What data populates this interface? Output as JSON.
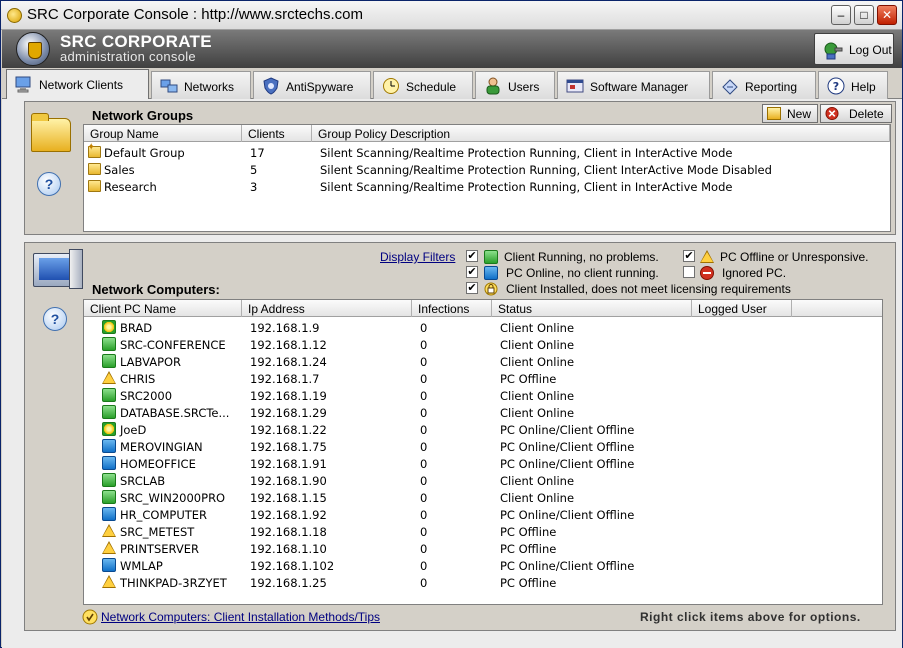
{
  "window": {
    "title": "SRC Corporate Console : http://www.srctechs.com"
  },
  "header": {
    "brand_line1": "SRC CORPORATE",
    "brand_line2": "administration console",
    "logout_label": "Log Out"
  },
  "tabs": [
    {
      "label": "Network Clients",
      "icon": "computer-icon",
      "active": true
    },
    {
      "label": "Networks",
      "icon": "network-icon",
      "active": false
    },
    {
      "label": "AntiSpyware",
      "icon": "shield-icon",
      "active": false
    },
    {
      "label": "Schedule",
      "icon": "clock-icon",
      "active": false
    },
    {
      "label": "Users",
      "icon": "user-icon",
      "active": false
    },
    {
      "label": "Software Manager",
      "icon": "software-icon",
      "active": false
    },
    {
      "label": "Reporting",
      "icon": "report-icon",
      "active": false
    },
    {
      "label": "Help",
      "icon": "help-icon",
      "active": false
    }
  ],
  "groups": {
    "title": "Network Groups",
    "new_label": "New",
    "delete_label": "Delete",
    "columns": [
      "Group Name",
      "Clients",
      "Group Policy Description"
    ],
    "rows": [
      {
        "name": "Default Group",
        "clients": "17",
        "policy": "Silent Scanning/Realtime Protection Running, Client in InterActive Mode"
      },
      {
        "name": "Sales",
        "clients": "5",
        "policy": "Silent Scanning/Realtime Protection Running, Client InterActive Mode Disabled"
      },
      {
        "name": "Research",
        "clients": "3",
        "policy": "Silent Scanning/Realtime Protection Running, Client in InterActive Mode"
      }
    ]
  },
  "computers": {
    "title": "Network Computers:",
    "filters_label": "Display Filters",
    "filters": [
      {
        "label": "Client Running, no problems.",
        "checked": true,
        "icon": "green-status-icon"
      },
      {
        "label": "PC Offline or Unresponsive.",
        "checked": true,
        "icon": "warning-icon"
      },
      {
        "label": "PC Online, no client running.",
        "checked": true,
        "icon": "blue-status-icon"
      },
      {
        "label": "Ignored PC.",
        "checked": false,
        "icon": "ignored-icon"
      },
      {
        "label": "Client Installed, does not meet licensing requirements",
        "checked": true,
        "icon": "license-icon"
      }
    ],
    "columns": [
      "Client PC Name",
      "Ip Address",
      "Infections",
      "Status",
      "Logged User"
    ],
    "rows": [
      {
        "name": "BRAD",
        "ip": "192.168.1.9",
        "infections": "0",
        "status": "Client Online",
        "icon": "star"
      },
      {
        "name": "SRC-CONFERENCE",
        "ip": "192.168.1.12",
        "infections": "0",
        "status": "Client Online",
        "icon": "green"
      },
      {
        "name": "LABVAPOR",
        "ip": "192.168.1.24",
        "infections": "0",
        "status": "Client Online",
        "icon": "green"
      },
      {
        "name": "CHRIS",
        "ip": "192.168.1.7",
        "infections": "0",
        "status": "PC Offline",
        "icon": "warn"
      },
      {
        "name": "SRC2000",
        "ip": "192.168.1.19",
        "infections": "0",
        "status": "Client Online",
        "icon": "green"
      },
      {
        "name": "DATABASE.SRCTe...",
        "ip": "192.168.1.29",
        "infections": "0",
        "status": "Client Online",
        "icon": "green"
      },
      {
        "name": "JoeD",
        "ip": "192.168.1.22",
        "infections": "0",
        "status": "PC Online/Client Offline",
        "icon": "star"
      },
      {
        "name": "MEROVINGIAN",
        "ip": "192.168.1.75",
        "infections": "0",
        "status": "PC Online/Client Offline",
        "icon": "blue"
      },
      {
        "name": "HOMEOFFICE",
        "ip": "192.168.1.91",
        "infections": "0",
        "status": "PC Online/Client Offline",
        "icon": "blue"
      },
      {
        "name": "SRCLAB",
        "ip": "192.168.1.90",
        "infections": "0",
        "status": "Client Online",
        "icon": "green"
      },
      {
        "name": "SRC_WIN2000PRO",
        "ip": "192.168.1.15",
        "infections": "0",
        "status": "Client Online",
        "icon": "green"
      },
      {
        "name": "HR_COMPUTER",
        "ip": "192.168.1.92",
        "infections": "0",
        "status": "PC Online/Client Offline",
        "icon": "blue"
      },
      {
        "name": "SRC_METEST",
        "ip": "192.168.1.18",
        "infections": "0",
        "status": "PC Offline",
        "icon": "warn"
      },
      {
        "name": "PRINTSERVER",
        "ip": "192.168.1.10",
        "infections": "0",
        "status": "PC Offline",
        "icon": "warn"
      },
      {
        "name": "WMLAP",
        "ip": "192.168.1.102",
        "infections": "0",
        "status": "PC Online/Client Offline",
        "icon": "blue"
      },
      {
        "name": "THINKPAD-3RZYET",
        "ip": "192.168.1.25",
        "infections": "0",
        "status": "PC Offline",
        "icon": "warn"
      }
    ],
    "install_link": "Network Computers: Client Installation Methods/Tips",
    "hint": "Right click items above for options."
  }
}
